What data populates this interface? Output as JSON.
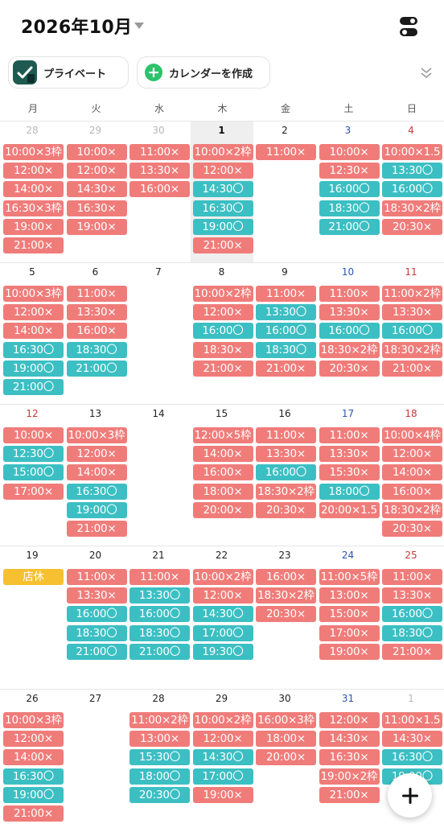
{
  "header": {
    "title": "2026年10月"
  },
  "chips": {
    "private_label": "プライベート",
    "create_label": "カレンダーを作成"
  },
  "weekdays": [
    "月",
    "火",
    "水",
    "木",
    "金",
    "土",
    "日"
  ],
  "colors": {
    "red": "#f07c7a",
    "teal": "#3cbfc3",
    "yellow": "#f6c030",
    "today_bg": "#efefef"
  },
  "weeks": [
    {
      "days": [
        {
          "label": "28",
          "tone": "muted",
          "events": [
            [
              "10:00×3枠",
              "red"
            ],
            [
              "12:00×",
              "red"
            ],
            [
              "14:00×",
              "red"
            ],
            [
              "16:30×3枠",
              "red"
            ],
            [
              "19:00×",
              "red"
            ],
            [
              "21:00×",
              "red"
            ]
          ]
        },
        {
          "label": "29",
          "tone": "muted",
          "events": [
            [
              "10:00×",
              "red"
            ],
            [
              "12:00×",
              "red"
            ],
            [
              "14:30×",
              "red"
            ],
            [
              "16:30×",
              "red"
            ],
            [
              "19:00×",
              "red"
            ]
          ]
        },
        {
          "label": "30",
          "tone": "muted",
          "events": [
            [
              "11:00×",
              "red"
            ],
            [
              "13:30×",
              "red"
            ],
            [
              "16:00×",
              "red"
            ]
          ]
        },
        {
          "label": "1",
          "tone": "bold",
          "today": true,
          "events": [
            [
              "10:00×2枠",
              "red"
            ],
            [
              "12:00×",
              "red"
            ],
            [
              "14:30〇",
              "teal"
            ],
            [
              "16:30〇",
              "teal"
            ],
            [
              "19:00〇",
              "teal"
            ],
            [
              "21:00×",
              "red"
            ]
          ]
        },
        {
          "label": "2",
          "tone": "",
          "events": [
            [
              "11:00×",
              "red"
            ]
          ]
        },
        {
          "label": "3",
          "tone": "sat",
          "events": [
            [
              "10:00×",
              "red"
            ],
            [
              "12:30×",
              "red"
            ],
            [
              "16:00〇",
              "teal"
            ],
            [
              "18:30〇",
              "teal"
            ],
            [
              "21:00〇",
              "teal"
            ]
          ]
        },
        {
          "label": "4",
          "tone": "sun",
          "events": [
            [
              "10:00×1.5",
              "red"
            ],
            [
              "13:30〇",
              "teal"
            ],
            [
              "16:00〇",
              "teal"
            ],
            [
              "18:30×2枠",
              "red"
            ],
            [
              "20:30×",
              "red"
            ]
          ]
        }
      ]
    },
    {
      "days": [
        {
          "label": "5",
          "tone": "",
          "events": [
            [
              "10:00×3枠",
              "red"
            ],
            [
              "12:00×",
              "red"
            ],
            [
              "14:00×",
              "red"
            ],
            [
              "16:30〇",
              "teal"
            ],
            [
              "19:00〇",
              "teal"
            ],
            [
              "21:00〇",
              "teal"
            ]
          ]
        },
        {
          "label": "6",
          "tone": "",
          "events": [
            [
              "11:00×",
              "red"
            ],
            [
              "13:30×",
              "red"
            ],
            [
              "16:00×",
              "red"
            ],
            [
              "18:30〇",
              "teal"
            ],
            [
              "21:00〇",
              "teal"
            ]
          ]
        },
        {
          "label": "7",
          "tone": "",
          "events": []
        },
        {
          "label": "8",
          "tone": "",
          "events": [
            [
              "10:00×2枠",
              "red"
            ],
            [
              "12:00×",
              "red"
            ],
            [
              "16:00〇",
              "teal"
            ],
            [
              "18:30×",
              "red"
            ],
            [
              "21:00×",
              "red"
            ]
          ]
        },
        {
          "label": "9",
          "tone": "",
          "events": [
            [
              "11:00×",
              "red"
            ],
            [
              "13:30〇",
              "teal"
            ],
            [
              "16:00〇",
              "teal"
            ],
            [
              "18:30〇",
              "teal"
            ],
            [
              "21:00×",
              "red"
            ]
          ]
        },
        {
          "label": "10",
          "tone": "sat",
          "events": [
            [
              "11:00×",
              "red"
            ],
            [
              "13:30×",
              "red"
            ],
            [
              "16:00〇",
              "teal"
            ],
            [
              "18:30×2枠",
              "red"
            ],
            [
              "20:30×",
              "red"
            ]
          ]
        },
        {
          "label": "11",
          "tone": "sun",
          "events": [
            [
              "11:00×2枠",
              "red"
            ],
            [
              "13:30×",
              "red"
            ],
            [
              "16:00〇",
              "teal"
            ],
            [
              "18:30×2枠",
              "red"
            ],
            [
              "21:00×",
              "red"
            ]
          ]
        }
      ]
    },
    {
      "days": [
        {
          "label": "12",
          "tone": "sun",
          "events": [
            [
              "10:00×",
              "red"
            ],
            [
              "12:30〇",
              "teal"
            ],
            [
              "15:00〇",
              "teal"
            ],
            [
              "17:00×",
              "red"
            ]
          ]
        },
        {
          "label": "13",
          "tone": "",
          "events": [
            [
              "10:00×3枠",
              "red"
            ],
            [
              "12:00×",
              "red"
            ],
            [
              "14:00×",
              "red"
            ],
            [
              "16:30〇",
              "teal"
            ],
            [
              "19:00〇",
              "teal"
            ],
            [
              "21:00×",
              "red"
            ]
          ]
        },
        {
          "label": "14",
          "tone": "",
          "events": []
        },
        {
          "label": "15",
          "tone": "",
          "events": [
            [
              "12:00×5枠",
              "red"
            ],
            [
              "14:00×",
              "red"
            ],
            [
              "16:00×",
              "red"
            ],
            [
              "18:00×",
              "red"
            ],
            [
              "20:00×",
              "red"
            ]
          ]
        },
        {
          "label": "16",
          "tone": "",
          "events": [
            [
              "11:00×",
              "red"
            ],
            [
              "13:30×",
              "red"
            ],
            [
              "16:00〇",
              "teal"
            ],
            [
              "18:30×2枠",
              "red"
            ],
            [
              "20:30×",
              "red"
            ]
          ]
        },
        {
          "label": "17",
          "tone": "sat",
          "events": [
            [
              "11:00×",
              "red"
            ],
            [
              "13:30×",
              "red"
            ],
            [
              "15:30×",
              "red"
            ],
            [
              "18:00〇",
              "teal"
            ],
            [
              "20:00×1.5",
              "red"
            ]
          ]
        },
        {
          "label": "18",
          "tone": "sun",
          "events": [
            [
              "10:00×4枠",
              "red"
            ],
            [
              "12:00×",
              "red"
            ],
            [
              "14:00×",
              "red"
            ],
            [
              "16:00×",
              "red"
            ],
            [
              "18:30×2枠",
              "red"
            ],
            [
              "20:30×",
              "red"
            ]
          ]
        }
      ]
    },
    {
      "days": [
        {
          "label": "19",
          "tone": "",
          "events": [
            [
              "店休",
              "yellow"
            ]
          ]
        },
        {
          "label": "20",
          "tone": "",
          "events": [
            [
              "11:00×",
              "red"
            ],
            [
              "13:30×",
              "red"
            ],
            [
              "16:00〇",
              "teal"
            ],
            [
              "18:30〇",
              "teal"
            ],
            [
              "21:00〇",
              "teal"
            ]
          ]
        },
        {
          "label": "21",
          "tone": "",
          "events": [
            [
              "11:00×",
              "red"
            ],
            [
              "13:30〇",
              "teal"
            ],
            [
              "16:00〇",
              "teal"
            ],
            [
              "18:30〇",
              "teal"
            ],
            [
              "21:00〇",
              "teal"
            ]
          ]
        },
        {
          "label": "22",
          "tone": "",
          "events": [
            [
              "10:00×2枠",
              "red"
            ],
            [
              "12:00×",
              "red"
            ],
            [
              "14:30〇",
              "teal"
            ],
            [
              "17:00〇",
              "teal"
            ],
            [
              "19:30〇",
              "teal"
            ]
          ]
        },
        {
          "label": "23",
          "tone": "",
          "events": [
            [
              "16:00×",
              "red"
            ],
            [
              "18:30×2枠",
              "red"
            ],
            [
              "20:30×",
              "red"
            ]
          ]
        },
        {
          "label": "24",
          "tone": "sat",
          "events": [
            [
              "11:00×5枠",
              "red"
            ],
            [
              "13:00×",
              "red"
            ],
            [
              "15:00×",
              "red"
            ],
            [
              "17:00×",
              "red"
            ],
            [
              "19:00×",
              "red"
            ]
          ]
        },
        {
          "label": "25",
          "tone": "sun",
          "events": [
            [
              "11:00×",
              "red"
            ],
            [
              "13:30×",
              "red"
            ],
            [
              "16:00〇",
              "teal"
            ],
            [
              "18:30〇",
              "teal"
            ],
            [
              "21:00×",
              "red"
            ]
          ]
        }
      ]
    },
    {
      "days": [
        {
          "label": "26",
          "tone": "",
          "events": [
            [
              "10:00×3枠",
              "red"
            ],
            [
              "12:00×",
              "red"
            ],
            [
              "14:00×",
              "red"
            ],
            [
              "16:30〇",
              "teal"
            ],
            [
              "19:00〇",
              "teal"
            ],
            [
              "21:00×",
              "red"
            ]
          ]
        },
        {
          "label": "27",
          "tone": "",
          "events": []
        },
        {
          "label": "28",
          "tone": "",
          "events": [
            [
              "11:00×2枠",
              "red"
            ],
            [
              "13:00×",
              "red"
            ],
            [
              "15:30〇",
              "teal"
            ],
            [
              "18:00〇",
              "teal"
            ],
            [
              "20:30〇",
              "teal"
            ]
          ]
        },
        {
          "label": "29",
          "tone": "",
          "events": [
            [
              "10:00×2枠",
              "red"
            ],
            [
              "12:00×",
              "red"
            ],
            [
              "14:30〇",
              "teal"
            ],
            [
              "17:00〇",
              "teal"
            ],
            [
              "19:00×",
              "red"
            ]
          ]
        },
        {
          "label": "30",
          "tone": "",
          "events": [
            [
              "16:00×3枠",
              "red"
            ],
            [
              "18:00×",
              "red"
            ],
            [
              "20:00×",
              "red"
            ]
          ]
        },
        {
          "label": "31",
          "tone": "sat",
          "events": [
            [
              "12:00×",
              "red"
            ],
            [
              "14:30×",
              "red"
            ],
            [
              "16:30×",
              "red"
            ],
            [
              "19:00×2枠",
              "red"
            ],
            [
              "21:00×",
              "red"
            ]
          ]
        },
        {
          "label": "1",
          "tone": "muted",
          "events": [
            [
              "11:00×1.5",
              "red"
            ],
            [
              "14:30×",
              "red"
            ],
            [
              "16:30〇",
              "teal"
            ],
            [
              "19:00〇",
              "teal"
            ]
          ]
        }
      ]
    }
  ]
}
